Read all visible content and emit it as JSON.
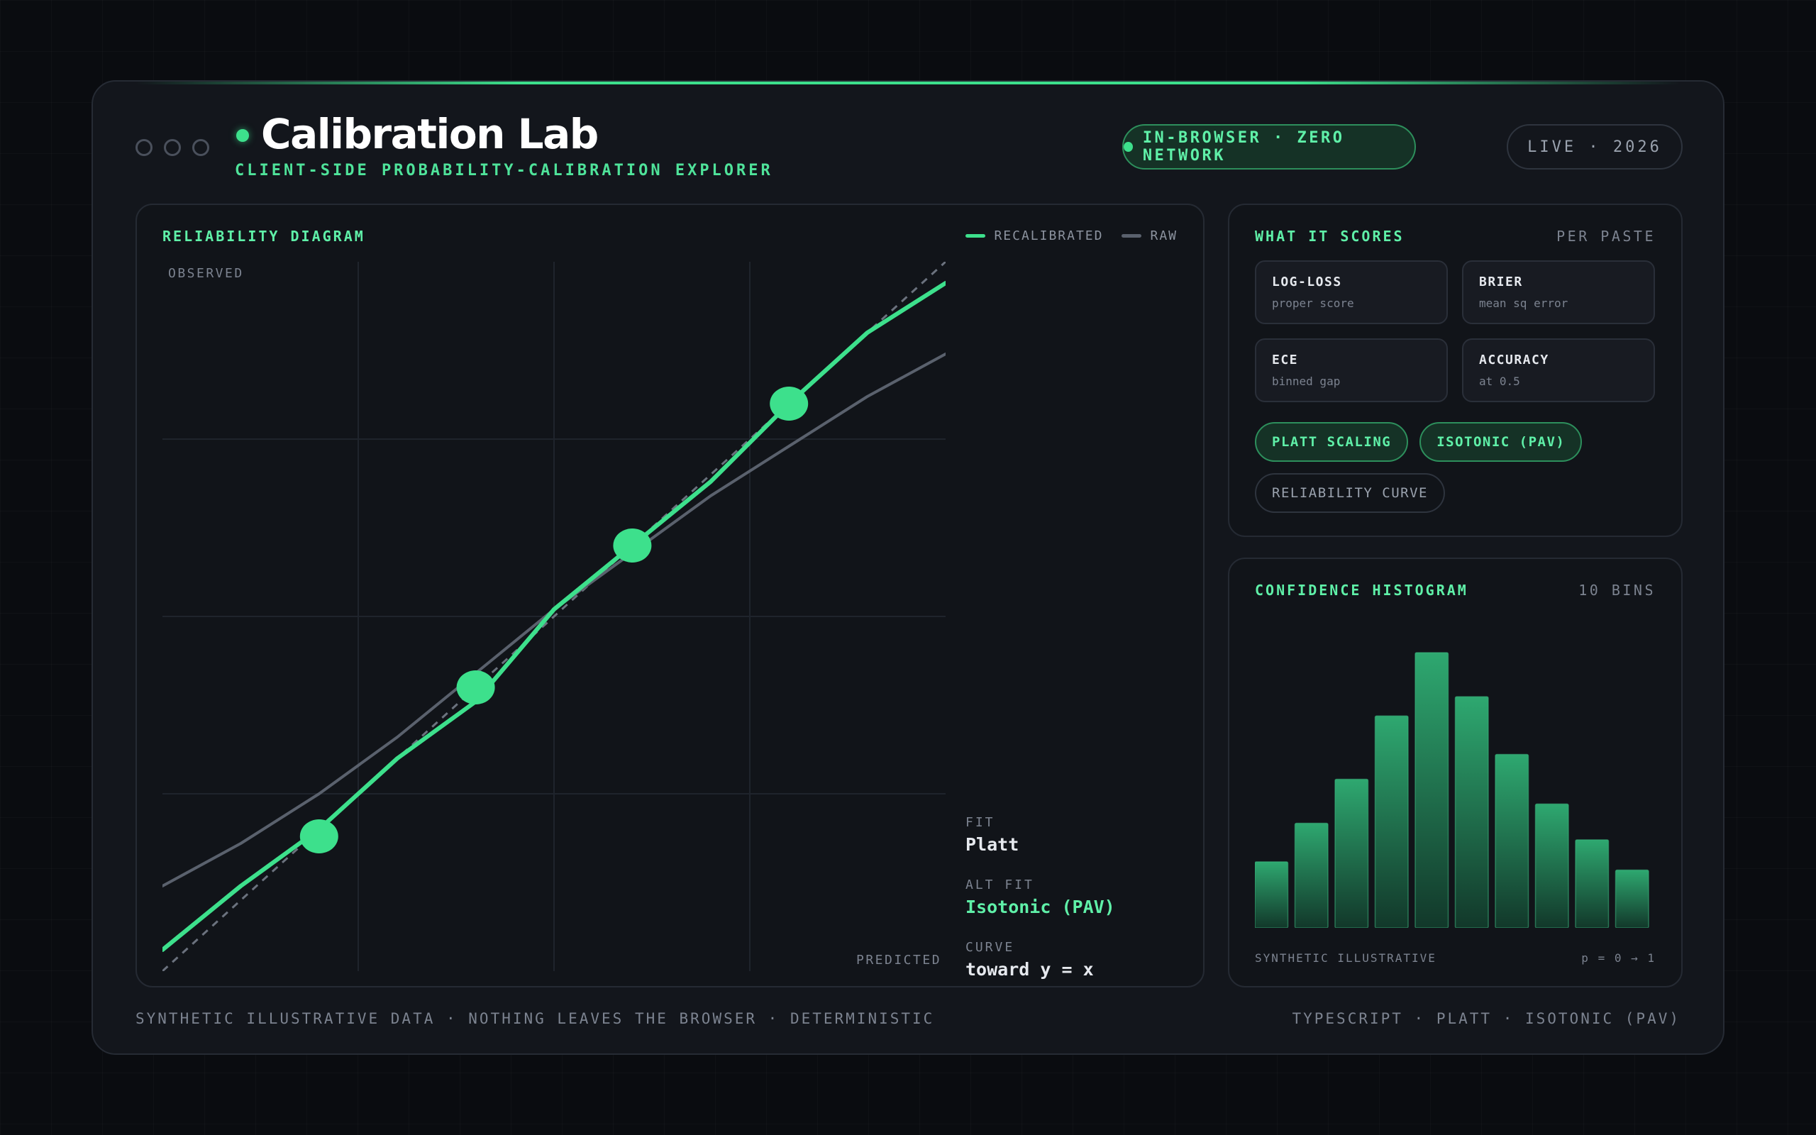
{
  "app": {
    "title": "Calibration Lab",
    "subtitle": "CLIENT-SIDE PROBABILITY-CALIBRATION EXPLORER",
    "badge_network": "IN-BROWSER · ZERO NETWORK",
    "badge_live": "LIVE · 2026"
  },
  "colors": {
    "accent": "#3de08c",
    "raw": "#5a616d",
    "background": "#13161c"
  },
  "reliability": {
    "title": "RELIABILITY DIAGRAM",
    "legend_recalibrated": "RECALIBRATED",
    "legend_raw": "RAW",
    "ylabel": "OBSERVED",
    "xlabel": "PREDICTED",
    "fit_label": "FIT",
    "fit_value": "Platt",
    "alt_fit_label": "ALT FIT",
    "alt_fit_value": "Isotonic (PAV)",
    "curve_label": "CURVE",
    "curve_value": "toward y = x"
  },
  "scores": {
    "title": "WHAT IT SCORES",
    "meta": "PER PASTE",
    "cards": [
      {
        "title": "LOG-LOSS",
        "sub": "proper score"
      },
      {
        "title": "BRIER",
        "sub": "mean sq error"
      },
      {
        "title": "ECE",
        "sub": "binned gap"
      },
      {
        "title": "ACCURACY",
        "sub": "at 0.5"
      }
    ],
    "chips": [
      "PLATT SCALING",
      "ISOTONIC (PAV)",
      "RELIABILITY CURVE"
    ]
  },
  "histogram": {
    "title": "CONFIDENCE HISTOGRAM",
    "meta": "10 BINS",
    "foot_left": "SYNTHETIC ILLUSTRATIVE",
    "foot_right": "p = 0 → 1"
  },
  "footer": {
    "left": "SYNTHETIC ILLUSTRATIVE DATA · NOTHING LEAVES THE BROWSER · DETERMINISTIC",
    "right": "TYPESCRIPT · PLATT · ISOTONIC (PAV)"
  },
  "chart_data": [
    {
      "type": "line",
      "xlabel": "PREDICTED",
      "ylabel": "OBSERVED",
      "xlim": [
        0,
        1
      ],
      "ylim": [
        0,
        1
      ],
      "grid": true,
      "legend": "top-right",
      "x": [
        0,
        0.1,
        0.2,
        0.3,
        0.4,
        0.5,
        0.6,
        0.7,
        0.8,
        0.9,
        1.0
      ],
      "series": [
        {
          "name": "RECALIBRATED",
          "values": [
            0.03,
            0.12,
            0.2,
            0.3,
            0.38,
            0.51,
            0.6,
            0.69,
            0.8,
            0.9,
            0.97
          ]
        },
        {
          "name": "RAW",
          "values": [
            0.12,
            0.18,
            0.25,
            0.33,
            0.42,
            0.51,
            0.59,
            0.67,
            0.74,
            0.81,
            0.87
          ]
        }
      ],
      "reference_line": "y = x",
      "markers": [
        [
          0.2,
          0.19
        ],
        [
          0.4,
          0.4
        ],
        [
          0.6,
          0.6
        ],
        [
          0.8,
          0.8
        ]
      ]
    },
    {
      "type": "bar",
      "categories": [
        "1",
        "2",
        "3",
        "4",
        "5",
        "6",
        "7",
        "8",
        "9",
        "10"
      ],
      "values": [
        0.24,
        0.38,
        0.54,
        0.77,
        1.0,
        0.84,
        0.63,
        0.45,
        0.32,
        0.21
      ]
    }
  ]
}
